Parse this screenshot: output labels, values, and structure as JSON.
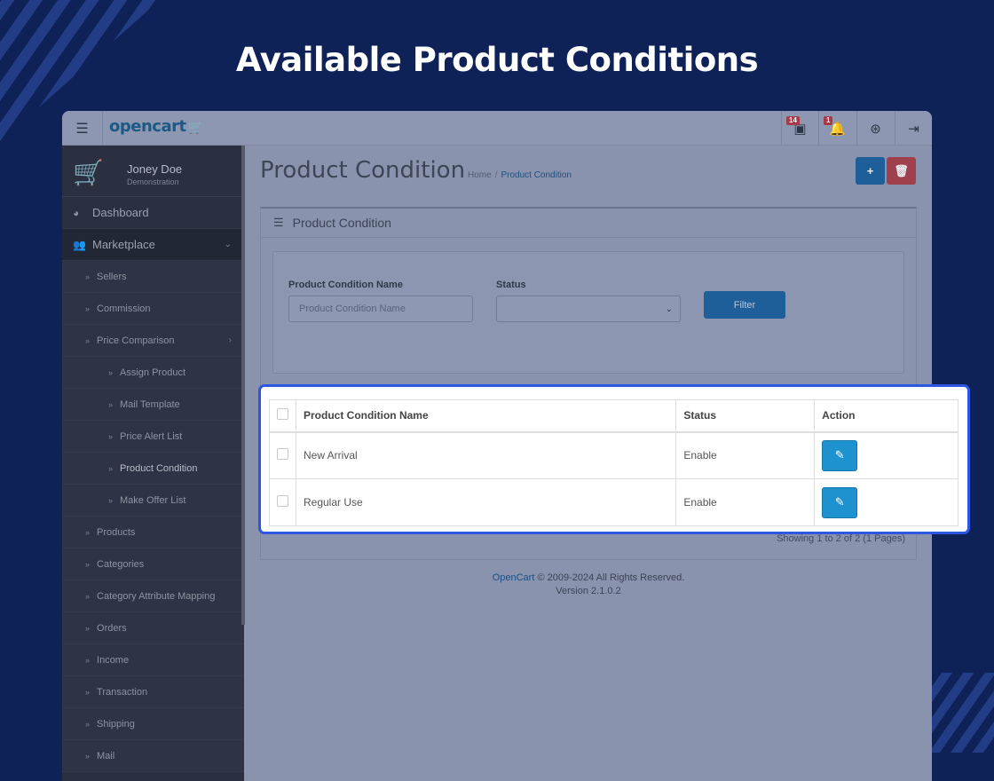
{
  "hero": {
    "title": "Available Product Conditions"
  },
  "header": {
    "logo_text": "opencart",
    "icons": [
      {
        "name": "store-icon",
        "badge": "14"
      },
      {
        "name": "bell-icon",
        "badge": "1"
      },
      {
        "name": "help-icon",
        "badge": ""
      },
      {
        "name": "logout-icon",
        "badge": ""
      }
    ]
  },
  "sidebar": {
    "user_name": "Joney Doe",
    "user_role": "Demonstration",
    "items": [
      {
        "label": "Dashboard"
      },
      {
        "label": "Marketplace"
      },
      {
        "label": "Sellers"
      },
      {
        "label": "Commission"
      },
      {
        "label": "Price Comparison"
      },
      {
        "label": "Assign Product"
      },
      {
        "label": "Mail Template"
      },
      {
        "label": "Price Alert List"
      },
      {
        "label": "Product Condition"
      },
      {
        "label": "Make Offer List"
      },
      {
        "label": "Products"
      },
      {
        "label": "Categories"
      },
      {
        "label": "Category Attribute Mapping"
      },
      {
        "label": "Orders"
      },
      {
        "label": "Income"
      },
      {
        "label": "Transaction"
      },
      {
        "label": "Shipping"
      },
      {
        "label": "Mail"
      }
    ]
  },
  "page": {
    "title": "Product Condition",
    "breadcrumb": {
      "home": "Home",
      "sep": "/",
      "current": "Product Condition"
    },
    "add_label": "+",
    "delete_label": "🗑"
  },
  "panel": {
    "heading": "Product Condition",
    "filter": {
      "name_label": "Product Condition Name",
      "name_placeholder": "Product Condition Name",
      "status_label": "Status",
      "status_value": "",
      "button_label": "Filter"
    },
    "table": {
      "columns": [
        "Product Condition Name",
        "Status",
        "Action"
      ],
      "rows": [
        {
          "name": "New Arrival",
          "status": "Enable"
        },
        {
          "name": "Regular Use",
          "status": "Enable"
        }
      ]
    },
    "showing": "Showing 1 to 2 of 2 (1 Pages)"
  },
  "footer": {
    "brand": "OpenCart",
    "copyright": " © 2009-2024 All Rights Reserved.",
    "version": "Version 2.1.0.2"
  },
  "colors": {
    "background": "#0f2257",
    "highlight_border": "#2d57e0",
    "primary_button": "#1e91cf",
    "danger_button": "#a0404d"
  }
}
